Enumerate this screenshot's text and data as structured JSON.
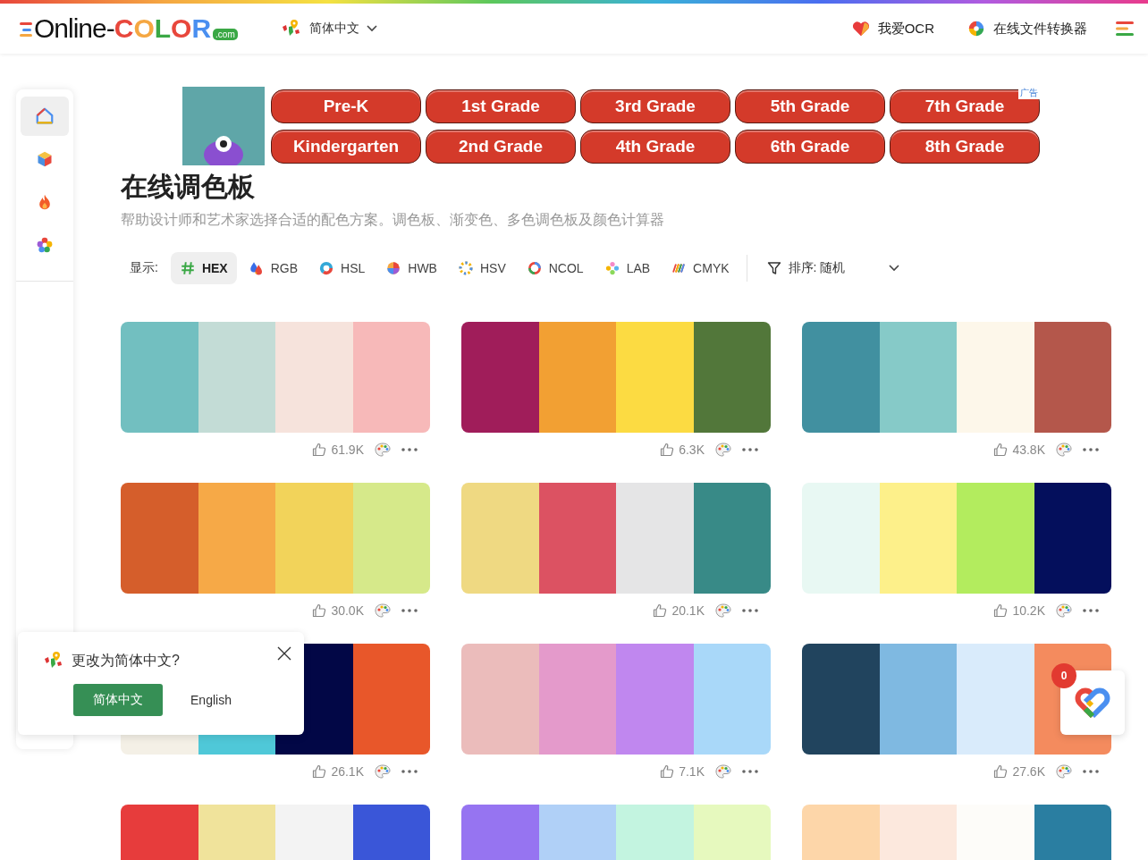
{
  "header": {
    "logo": {
      "text": "Online-",
      "accent": "COLOR",
      "suffix": ".com"
    },
    "language": "简体中文",
    "links": [
      {
        "kind": "heart",
        "label": "我爱OCR"
      },
      {
        "kind": "swirl",
        "label": "在线文件转换器"
      }
    ]
  },
  "sidebar": {
    "items": [
      {
        "kind": "home",
        "selected": true
      },
      {
        "kind": "cube",
        "selected": false
      },
      {
        "kind": "flame",
        "selected": false
      },
      {
        "kind": "flower",
        "selected": false
      }
    ]
  },
  "ad": {
    "label": "广告",
    "buttons": [
      "Pre-K",
      "1st Grade",
      "3rd Grade",
      "5th Grade",
      "7th Grade",
      "Kindergarten",
      "2nd Grade",
      "4th Grade",
      "6th Grade",
      "8th Grade"
    ]
  },
  "title": "在线调色板",
  "subtitle": "帮助设计师和艺术家选择合适的配色方案。调色板、渐变色、多色调色板及颜色计算器",
  "toolbar": {
    "label": "显示:",
    "formats": [
      {
        "label": "HEX",
        "selected": true
      },
      {
        "label": "RGB",
        "selected": false
      },
      {
        "label": "HSL",
        "selected": false
      },
      {
        "label": "HWB",
        "selected": false
      },
      {
        "label": "HSV",
        "selected": false
      },
      {
        "label": "NCOL",
        "selected": false
      },
      {
        "label": "LAB",
        "selected": false
      },
      {
        "label": "CMYK",
        "selected": false
      }
    ],
    "sort": "排序: 随机"
  },
  "palettes": [
    {
      "swatches": [
        {
          "color": "#72bfc0"
        },
        {
          "color": "#c3dcd6"
        },
        {
          "color": "#f6e3dc"
        },
        {
          "color": "#f7b9b9"
        }
      ],
      "likes": "61.9K"
    },
    {
      "swatches": [
        {
          "color": "#a01d5a"
        },
        {
          "color": "#f2a033"
        },
        {
          "color": "#fcdb42"
        },
        {
          "color": "#52773a"
        }
      ],
      "likes": "6.3K"
    },
    {
      "swatches": [
        {
          "color": "#4190a0"
        },
        {
          "color": "#86cac8"
        },
        {
          "color": "#fdf7ea"
        },
        {
          "color": "#b4574b"
        }
      ],
      "likes": "43.8K"
    },
    {
      "swatches": [
        {
          "color": "#d55e2b"
        },
        {
          "color": "#f6a947"
        },
        {
          "color": "#f2d35a"
        },
        {
          "color": "#d6e98a"
        }
      ],
      "likes": "30.0K"
    },
    {
      "swatches": [
        {
          "color": "#efd982"
        },
        {
          "color": "#dc5262"
        },
        {
          "color": "#e5e5e6"
        },
        {
          "color": "#388a87"
        }
      ],
      "likes": "20.1K"
    },
    {
      "swatches": [
        {
          "color": "#e8f8f3"
        },
        {
          "color": "#fdf08a"
        },
        {
          "color": "#b3ec5e"
        },
        {
          "color": "#040f5c"
        }
      ],
      "likes": "10.2K"
    },
    {
      "swatches": [
        {
          "color": "#f4f0e6"
        },
        {
          "color": "#4fc8d8"
        },
        {
          "color": "#020746"
        },
        {
          "color": "#e8572a"
        }
      ],
      "likes": "26.1K"
    },
    {
      "swatches": [
        {
          "color": "#ebbcbb"
        },
        {
          "color": "#e49acb"
        },
        {
          "color": "#c087ef"
        },
        {
          "color": "#a9d8f9"
        }
      ],
      "likes": "7.1K"
    },
    {
      "swatches": [
        {
          "color": "#21445e"
        },
        {
          "color": "#7fb9e1"
        },
        {
          "color": "#d9ebfb"
        },
        {
          "color": "#f48b5e"
        }
      ],
      "likes": "27.6K"
    },
    {
      "swatches": [
        {
          "color": "#e73c3c"
        },
        {
          "color": "#f0e39b"
        },
        {
          "color": "#f3f3f3"
        },
        {
          "color": "#3a56d8"
        }
      ]
    },
    {
      "swatches": [
        {
          "color": "#9674f1"
        },
        {
          "color": "#b0d0f7"
        },
        {
          "color": "#c3f4e0"
        },
        {
          "color": "#e6f9be"
        }
      ]
    },
    {
      "swatches": [
        {
          "color": "#fdd6a9"
        },
        {
          "color": "#fce8dd"
        },
        {
          "color": "#fdfcf9"
        },
        {
          "color": "#2a7ea1"
        }
      ]
    }
  ],
  "language_popup": {
    "question": "更改为简体中文?",
    "buttons": [
      {
        "label": "简体中文",
        "selected": true
      },
      {
        "label": "English",
        "selected": false
      }
    ]
  },
  "gift_widget": {
    "badge": "0"
  }
}
